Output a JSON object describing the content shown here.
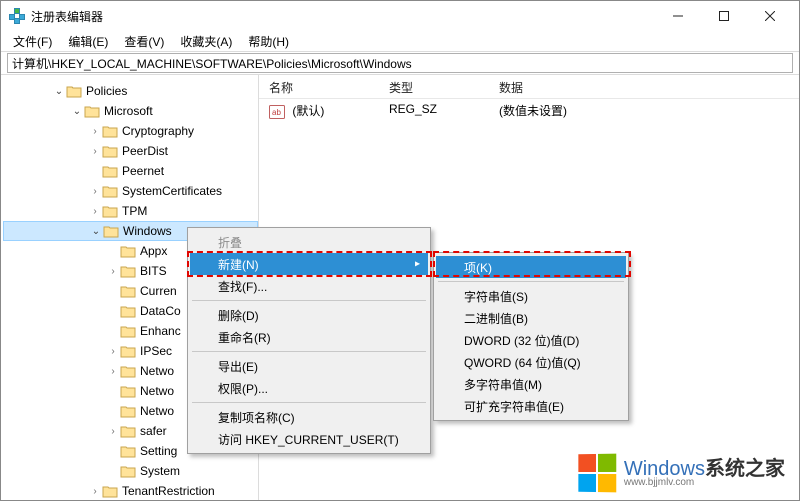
{
  "window": {
    "title": "注册表编辑器"
  },
  "menubar": {
    "file": "文件(F)",
    "edit": "编辑(E)",
    "view": "查看(V)",
    "favorites": "收藏夹(A)",
    "help": "帮助(H)"
  },
  "address": {
    "path": "计算机\\HKEY_LOCAL_MACHINE\\SOFTWARE\\Policies\\Microsoft\\Windows"
  },
  "tree": {
    "policies": "Policies",
    "microsoft": "Microsoft",
    "items2": [
      "Cryptography",
      "PeerDist",
      "Peernet",
      "SystemCertificates",
      "TPM"
    ],
    "windows": "Windows",
    "win_children": [
      "Appx",
      "BITS",
      "Curren",
      "DataCo",
      "Enhanc",
      "IPSec",
      "Netwo",
      "Netwo",
      "Netwo",
      "safer",
      "Setting",
      "System"
    ],
    "tenant": "TenantRestriction"
  },
  "list": {
    "headers": {
      "name": "名称",
      "type": "类型",
      "data": "数据"
    },
    "rows": [
      {
        "icon": "str",
        "name": "(默认)",
        "type": "REG_SZ",
        "data": "(数值未设置)"
      }
    ]
  },
  "context1": {
    "collapse": "折叠",
    "new": "新建(N)",
    "find": "查找(F)...",
    "delete": "删除(D)",
    "rename": "重命名(R)",
    "export": "导出(E)",
    "permissions": "权限(P)...",
    "copykey": "复制项名称(C)",
    "gohkcu": "访问 HKEY_CURRENT_USER(T)"
  },
  "context2": {
    "key": "项(K)",
    "string": "字符串值(S)",
    "binary": "二进制值(B)",
    "dword": "DWORD (32 位)值(D)",
    "qword": "QWORD (64 位)值(Q)",
    "multi": "多字符串值(M)",
    "expand": "可扩充字符串值(E)"
  },
  "watermark": {
    "brand": "Windows",
    "suffix": "系统之家",
    "url": "www.bjjmlv.com"
  }
}
